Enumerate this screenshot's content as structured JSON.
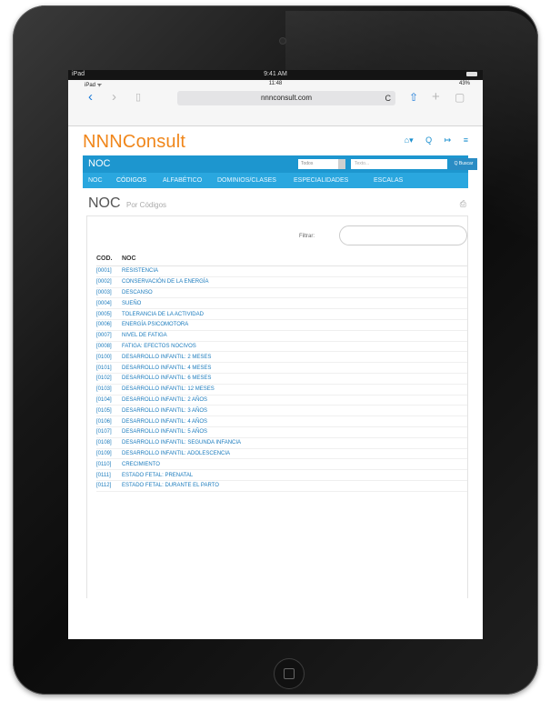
{
  "device": {
    "status_left": "iPad",
    "status_time": "9:41 AM"
  },
  "safari": {
    "status_left": "iPad ᯤ",
    "status_time": "11:48",
    "status_right": "43%",
    "url": "nnnconsult.com",
    "back_icon": "‹",
    "forward_icon": "›",
    "bookmarks_icon": "▯",
    "reload_icon": "C",
    "share_icon": "⇧",
    "add_icon": "+",
    "tabs_icon": "▢"
  },
  "brand": "NNNConsult",
  "brand_icons": {
    "home": "⌂▾",
    "search": "Q",
    "login": "↦",
    "menu": "≡"
  },
  "appbar": {
    "title": "NOC",
    "select_value": "Todos",
    "search_placeholder": "Texto...",
    "search_button": "Q Buscar"
  },
  "tabs": [
    "NOC",
    "CÓDIGOS",
    "ALFABÉTICO",
    "DOMINIOS/CLASES",
    "ESPECIALIDADES",
    "ESCALAS"
  ],
  "page": {
    "title": "NOC",
    "subtitle": "Por Códigos",
    "print_icon": "⎙"
  },
  "filter_label": "Filtrar:",
  "table": {
    "headers": [
      "COD.",
      "NOC"
    ],
    "rows": [
      [
        "[0001]",
        "RESISTENCIA"
      ],
      [
        "[0002]",
        "CONSERVACIÓN DE LA ENERGÍA"
      ],
      [
        "[0003]",
        "DESCANSO"
      ],
      [
        "[0004]",
        "SUEÑO"
      ],
      [
        "[0005]",
        "TOLERANCIA DE LA ACTIVIDAD"
      ],
      [
        "[0006]",
        "ENERGÍA PSICOMOTORA"
      ],
      [
        "[0007]",
        "NIVEL DE FATIGA"
      ],
      [
        "[0008]",
        "FATIGA: EFECTOS NOCIVOS"
      ],
      [
        "[0100]",
        "DESARROLLO INFANTIL: 2 MESES"
      ],
      [
        "[0101]",
        "DESARROLLO INFANTIL: 4 MESES"
      ],
      [
        "[0102]",
        "DESARROLLO INFANTIL: 6 MESES"
      ],
      [
        "[0103]",
        "DESARROLLO INFANTIL: 12 MESES"
      ],
      [
        "[0104]",
        "DESARROLLO INFANTIL: 2 AÑOS"
      ],
      [
        "[0105]",
        "DESARROLLO INFANTIL: 3 AÑOS"
      ],
      [
        "[0106]",
        "DESARROLLO INFANTIL: 4 AÑOS"
      ],
      [
        "[0107]",
        "DESARROLLO INFANTIL: 5 AÑOS"
      ],
      [
        "[0108]",
        "DESARROLLO INFANTIL: SEGUNDA INFANCIA"
      ],
      [
        "[0109]",
        "DESARROLLO INFANTIL: ADOLESCENCIA"
      ],
      [
        "[0110]",
        "CRECIMIENTO"
      ],
      [
        "[0111]",
        "ESTADO FETAL: PRENATAL"
      ],
      [
        "[0112]",
        "ESTADO FETAL: DURANTE EL PARTO"
      ]
    ]
  },
  "colors": {
    "brand": "#f0861a",
    "appbar": "#1d96cf",
    "tabs": "#2aa7df",
    "link": "#1b7bbd"
  }
}
